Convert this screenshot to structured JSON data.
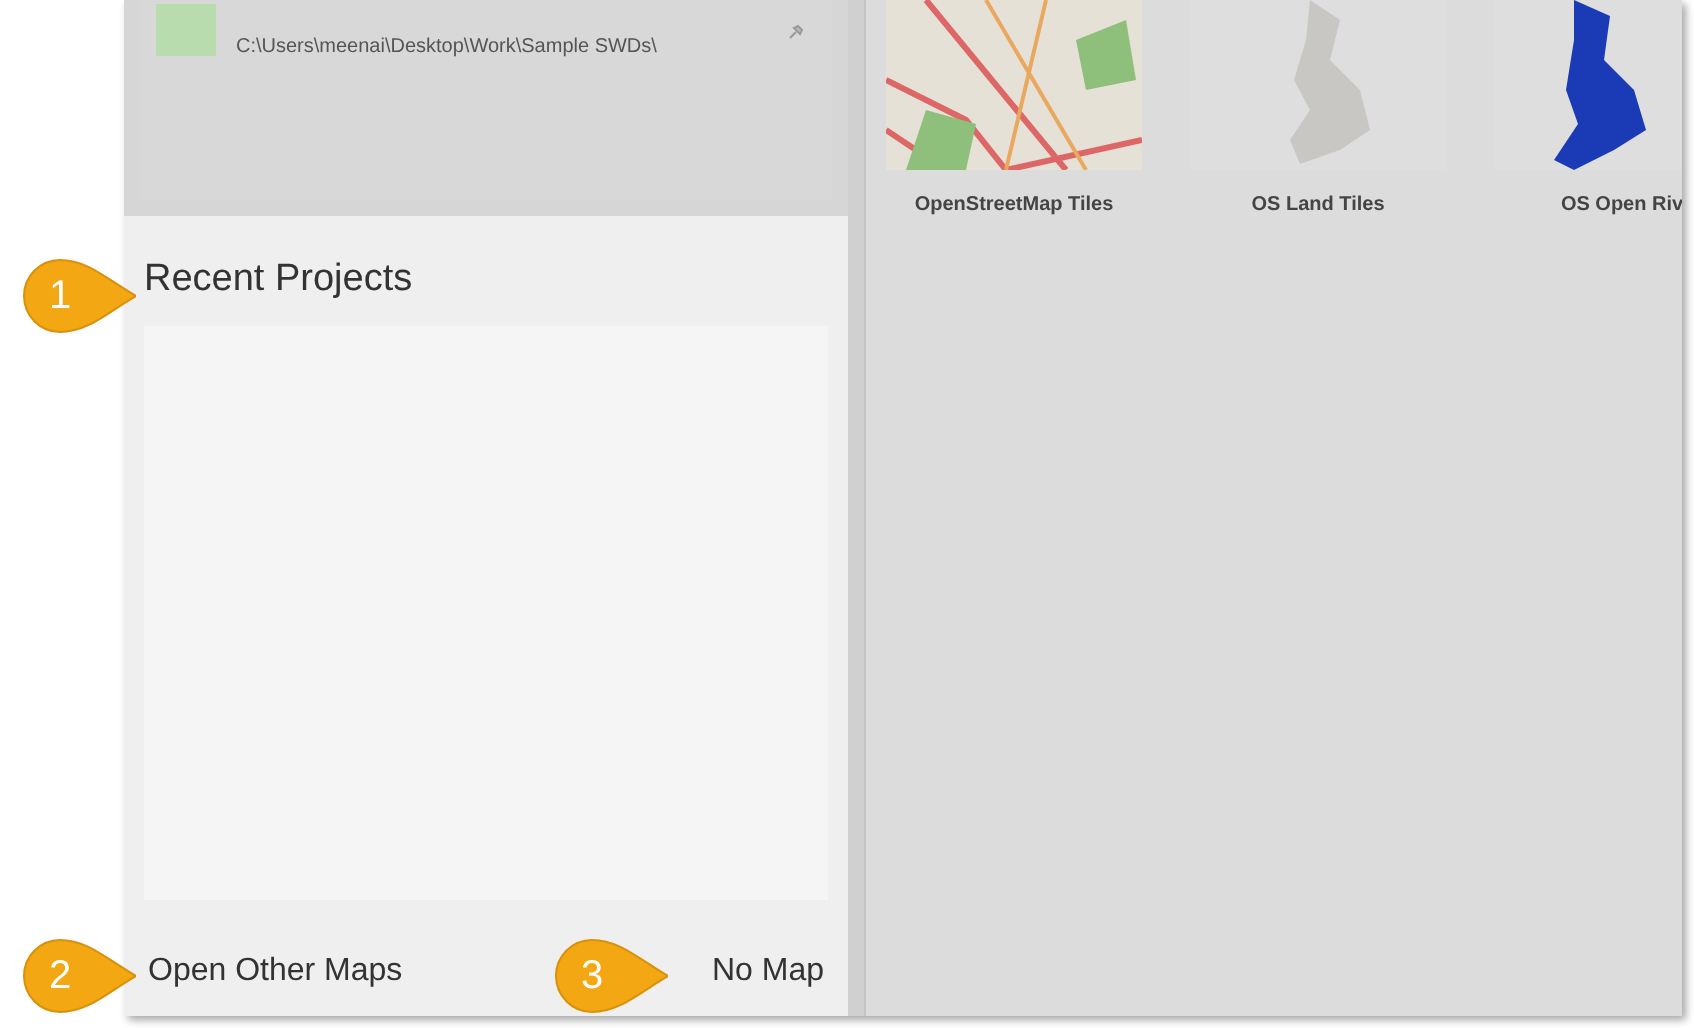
{
  "recent_file": {
    "path": "C:\\Users\\meenai\\Desktop\\Work\\Sample SWDs\\"
  },
  "recent_projects": {
    "title": "Recent Projects"
  },
  "footer": {
    "links": [
      "Open Other Maps",
      "No Map"
    ]
  },
  "tiles": [
    {
      "label": "OpenStreetMap Tiles",
      "kind": "streets"
    },
    {
      "label": "OS Land Tiles",
      "kind": "land"
    },
    {
      "label": "OS Open Riv",
      "kind": "rivers"
    }
  ],
  "callouts": [
    {
      "number": "1"
    },
    {
      "number": "2"
    },
    {
      "number": "3"
    }
  ]
}
